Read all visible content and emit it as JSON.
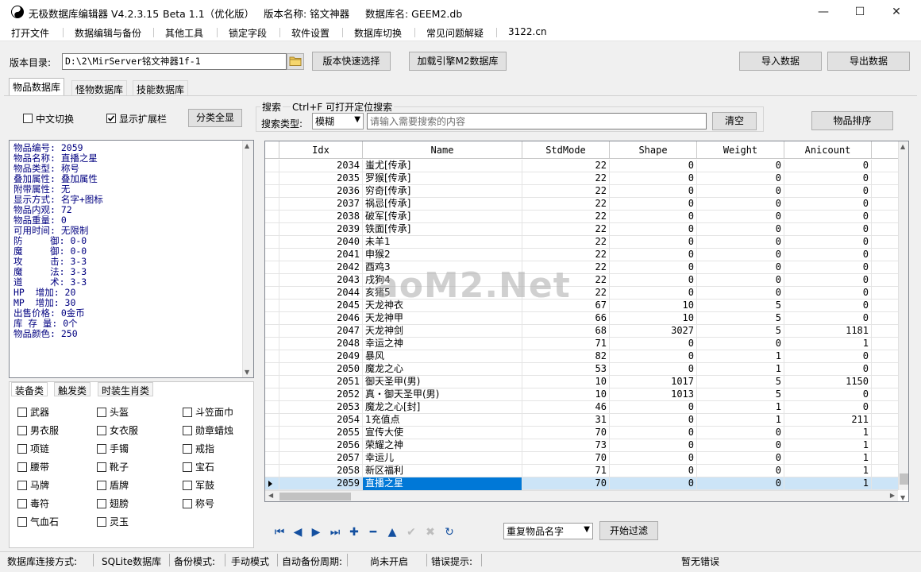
{
  "window": {
    "app_title": "无极数据库编辑器 V4.2.3.15",
    "beta": "Beta 1.1（优化版）",
    "version_name": "版本名称: 铭文神器",
    "db_name": "数据库名: GEEM2.db",
    "controls": {
      "minimize": "—",
      "maximize": "☐",
      "close": "✕"
    }
  },
  "menu": [
    "打开文件",
    "数据编辑与备份",
    "其他工具",
    "锁定字段",
    "软件设置",
    "数据库切换",
    "常见问题解疑",
    "3122.cn"
  ],
  "toolbar": {
    "dir_label": "版本目录:",
    "dir_value": "D:\\2\\MirServer铭文神器1f-1",
    "quick_select": "版本快速选择",
    "load_engine": "加载引擎M2数据库",
    "import": "导入数据",
    "export": "导出数据"
  },
  "tabs": [
    "物品数据库",
    "怪物数据库",
    "技能数据库"
  ],
  "options": {
    "chinese_toggle": "中文切换",
    "chinese_checked": false,
    "show_ext": "显示扩展栏",
    "show_ext_checked": true,
    "show_all": "分类全显"
  },
  "search": {
    "group_label": "搜索",
    "hint": "Ctrl+F 可打开定位搜索",
    "type_label": "搜索类型:",
    "type_value": "模糊",
    "placeholder": "请输入需要搜索的内容",
    "clear": "清空",
    "sort": "物品排序"
  },
  "info_lines": [
    "物品编号: 2059",
    "物品名称: 直播之星",
    "物品类型: 称号",
    "叠加属性: 叠加属性",
    "附带属性: 无",
    "显示方式: 名字+图标",
    "物品内观: 72",
    "物品重量: 0",
    "可用时间: 无限制",
    "防     御: 0-0",
    "魔     御: 0-0",
    "攻     击: 3-3",
    "魔     法: 3-3",
    "道     术: 3-3",
    "HP  增加: 20",
    "MP  增加: 30",
    "出售价格: 0金币",
    "库 存 量: 0个",
    "物品颜色: 250"
  ],
  "category_tabs": [
    "装备类",
    "触发类",
    "时装生肖类"
  ],
  "categories": [
    [
      "武器",
      "头盔",
      "斗笠面巾"
    ],
    [
      "男衣服",
      "女衣服",
      "勋章蜡烛"
    ],
    [
      "项链",
      "手镯",
      "戒指"
    ],
    [
      "腰带",
      "靴子",
      "宝石"
    ],
    [
      "马牌",
      "盾牌",
      "军鼓"
    ],
    [
      "毒符",
      "翅膀",
      "称号"
    ],
    [
      "气血石",
      "灵玉",
      ""
    ]
  ],
  "grid": {
    "columns": [
      "Idx",
      "Name",
      "StdMode",
      "Shape",
      "Weight",
      "Anicount"
    ],
    "rows": [
      [
        "2034",
        "蚩尤[传承]",
        "22",
        "0",
        "0",
        "0"
      ],
      [
        "2035",
        "罗猴[传承]",
        "22",
        "0",
        "0",
        "0"
      ],
      [
        "2036",
        "穷奇[传承]",
        "22",
        "0",
        "0",
        "0"
      ],
      [
        "2037",
        "祸忌[传承]",
        "22",
        "0",
        "0",
        "0"
      ],
      [
        "2038",
        "破军[传承]",
        "22",
        "0",
        "0",
        "0"
      ],
      [
        "2039",
        "铁面[传承]",
        "22",
        "0",
        "0",
        "0"
      ],
      [
        "2040",
        "未羊1",
        "22",
        "0",
        "0",
        "0"
      ],
      [
        "2041",
        "申猴2",
        "22",
        "0",
        "0",
        "0"
      ],
      [
        "2042",
        "酉鸡3",
        "22",
        "0",
        "0",
        "0"
      ],
      [
        "2043",
        "戌狗4",
        "22",
        "0",
        "0",
        "0"
      ],
      [
        "2044",
        "亥猪5",
        "22",
        "0",
        "0",
        "0"
      ],
      [
        "2045",
        "天龙神衣",
        "67",
        "10",
        "5",
        "0"
      ],
      [
        "2046",
        "天龙神甲",
        "66",
        "10",
        "5",
        "0"
      ],
      [
        "2047",
        "天龙神剑",
        "68",
        "3027",
        "5",
        "1181"
      ],
      [
        "2048",
        "幸运之神",
        "71",
        "0",
        "0",
        "1"
      ],
      [
        "2049",
        "暴风",
        "82",
        "0",
        "1",
        "0"
      ],
      [
        "2050",
        "魔龙之心",
        "53",
        "0",
        "1",
        "0"
      ],
      [
        "2051",
        "御天圣甲(男)",
        "10",
        "1017",
        "5",
        "1150"
      ],
      [
        "2052",
        "真・御天圣甲(男)",
        "10",
        "1013",
        "5",
        "0"
      ],
      [
        "2053",
        "魔龙之心[封]",
        "46",
        "0",
        "1",
        "0"
      ],
      [
        "2054",
        "1充值点",
        "31",
        "0",
        "1",
        "211"
      ],
      [
        "2055",
        "宣传大使",
        "70",
        "0",
        "0",
        "1"
      ],
      [
        "2056",
        "荣耀之神",
        "73",
        "0",
        "0",
        "1"
      ],
      [
        "2057",
        "幸运儿",
        "70",
        "0",
        "0",
        "1"
      ],
      [
        "2058",
        "新区福利",
        "71",
        "0",
        "0",
        "1"
      ],
      [
        "2059",
        "直播之星",
        "70",
        "0",
        "0",
        "1"
      ]
    ],
    "selected_index": 25
  },
  "navigator": {
    "icons": [
      "first-icon",
      "prior-icon",
      "next-icon",
      "last-icon",
      "insert-icon",
      "delete-icon",
      "edit-icon",
      "post-icon",
      "cancel-icon",
      "refresh-icon"
    ],
    "glyphs": [
      "⏮",
      "◀",
      "▶",
      "⏭",
      "✚",
      "━",
      "▲",
      "✔",
      "✖",
      "↻"
    ],
    "filter_value": "重复物品名字",
    "filter_button": "开始过滤"
  },
  "watermark": "aoM2.Net",
  "status": {
    "conn_label": "数据库连接方式:",
    "conn_value": "SQLite数据库",
    "backup_label": "备份模式:",
    "backup_value": "手动模式",
    "auto_label": "自动备份周期:",
    "auto_value": "尚未开启",
    "error_label": "错误提示:",
    "error_value": "暂无错误"
  },
  "colors": {
    "selection": "#0078d7",
    "row_selected": "#cce4f7",
    "info_text": "#000080"
  }
}
